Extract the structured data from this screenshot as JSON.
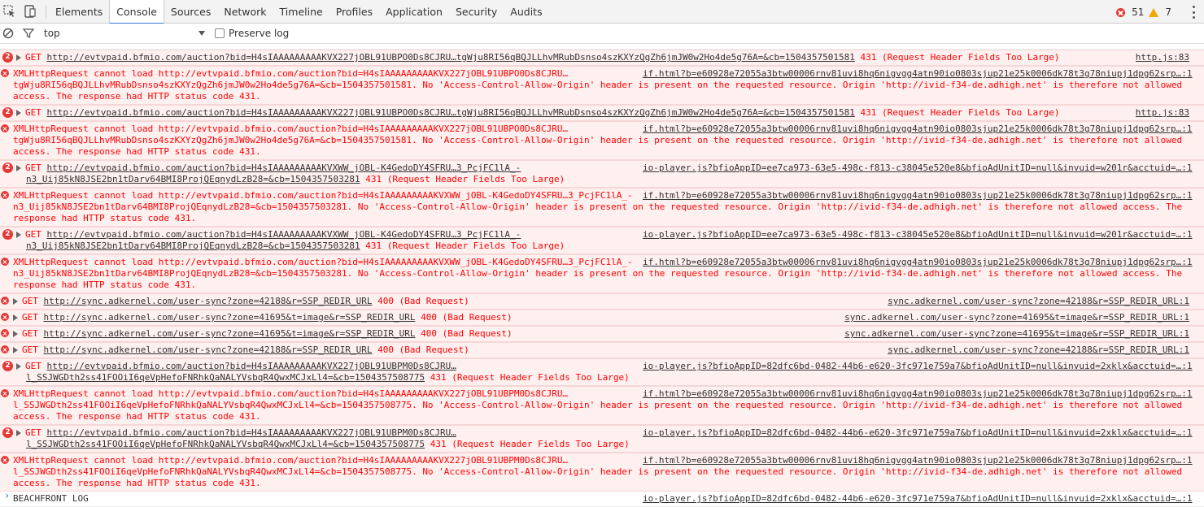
{
  "tabs": [
    "Elements",
    "Console",
    "Sources",
    "Network",
    "Timeline",
    "Profiles",
    "Application",
    "Security",
    "Audits"
  ],
  "active_tab": "Console",
  "counts": {
    "errors": "51",
    "warnings": "7"
  },
  "filter": {
    "context": "top",
    "preserve_log": "Preserve log"
  },
  "colors": {
    "error_bg": "#fff0f0",
    "error_text": "#ff0000",
    "badge": "#e53935",
    "accent": "#3879d9"
  },
  "rows": [
    {
      "type": "get",
      "count": "2",
      "url": "http://evtvpaid.bfmio.com/auction?bid=H4sIAAAAAAAAAKVX227jOBL91UBPO0Ds8CJRU…tgWju8RI56qBQJLLhvMRubDsnso4szKXYzQgZh6jmJW0w2Ho4de5g76A=&cb=1504357501581",
      "status": "431 (Request Header Fields Too Large)",
      "src": "http.js:83"
    },
    {
      "type": "xhr",
      "l1": "XMLHttpRequest cannot load http://evtvpaid.bfmio.com/auction?bid=H4sIAAAAAAAAAKVX227jOBL91UBPO0Ds8CJRU…",
      "l2": "tgWju8RI56qBQJLLhvMRubDsnso4szKXYzQgZh6jmJW0w2Ho4de5g76A=&cb=1504357501581. No 'Access-Control-Allow-Origin' header is present on the requested resource. Origin 'http://ivid-f34-de.adhigh.net' is therefore not allowed",
      "l3": "access. The response had HTTP status code 431.",
      "src": "if.html?b=e60928e72055a3btw00006rnv81uvi8hq6nigvgg4atn90io0803sjup21e25k0006dk78t3g78niupj1dpg62srp…:1"
    },
    {
      "type": "get",
      "count": "2",
      "url": "http://evtvpaid.bfmio.com/auction?bid=H4sIAAAAAAAAAKVX227jOBL91UBPO0Ds8CJRU…tgWju8RI56qBQJLLhvMRubDsnso4szKXYzQgZh6jmJW0w2Ho4de5g76A=&cb=1504357501581",
      "status": "431 (Request Header Fields Too Large)",
      "src": "http.js:83"
    },
    {
      "type": "xhr",
      "l1": "XMLHttpRequest cannot load http://evtvpaid.bfmio.com/auction?bid=H4sIAAAAAAAAAKVX227jOBL91UBPO0Ds8CJRU…",
      "l2": "tgWju8RI56qBQJLLhvMRubDsnso4szKXYzQgZh6jmJW0w2Ho4de5g76A=&cb=1504357501581. No 'Access-Control-Allow-Origin' header is present on the requested resource. Origin 'http://ivid-f34-de.adhigh.net' is therefore not allowed",
      "l3": "access. The response had HTTP status code 431.",
      "src": "if.html?b=e60928e72055a3btw00006rnv81uvi8hq6nigvgg4atn90io0803sjup21e25k0006dk78t3g78niupj1dpg62srp…:1"
    },
    {
      "type": "get2",
      "count": "2",
      "url": "http://evtvpaid.bfmio.com/auction?bid=H4sIAAAAAAAAAKVXWW_jOBL-K4GedoDY4SFRU…3_PcjFC1lA_-",
      "url2": "n3_Uij85kN8JSE2bn1tDarv64BMI8ProjQEqnydLzB28=&cb=1504357503281",
      "status": "431 (Request Header Fields Too Large)",
      "src": "io-player.js?bfioAppID=ee7ca973-63e5-498c-f813-c38045e520e8&bfioAdUnitID=null&invuid=w201r&acctuid=…:1"
    },
    {
      "type": "xhr",
      "l1": "XMLHttpRequest cannot load http://evtvpaid.bfmio.com/auction?bid=H4sIAAAAAAAAAKVXWW_jOBL-K4GedoDY4SFRU…3_PcjFC1lA_-",
      "l2": "n3_Uij85kN8JSE2bn1tDarv64BMI8ProjQEqnydLzB28=&cb=1504357503281. No 'Access-Control-Allow-Origin' header is present on the requested resource. Origin 'http://ivid-f34-de.adhigh.net' is therefore not allowed access. The",
      "l3": "response had HTTP status code 431.",
      "src": "if.html?b=e60928e72055a3btw00006rnv81uvi8hq6nigvgg4atn90io0803sjup21e25k0006dk78t3g78niupj1dpg62srp…:1"
    },
    {
      "type": "get2",
      "count": "2",
      "url": "http://evtvpaid.bfmio.com/auction?bid=H4sIAAAAAAAAAKVXWW_jOBL-K4GedoDY4SFRU…3_PcjFC1lA_-",
      "url2": "n3_Uij85kN8JSE2bn1tDarv64BMI8ProjQEqnydLzB28=&cb=1504357503281",
      "status": "431 (Request Header Fields Too Large)",
      "src": "io-player.js?bfioAppID=ee7ca973-63e5-498c-f813-c38045e520e8&bfioAdUnitID=null&invuid=w201r&acctuid=…:1"
    },
    {
      "type": "xhr",
      "l1": "XMLHttpRequest cannot load http://evtvpaid.bfmio.com/auction?bid=H4sIAAAAAAAAAKVXWW_jOBL-K4GedoDY4SFRU…3_PcjFC1lA_-",
      "l2": "n3_Uij85kN8JSE2bn1tDarv64BMI8ProjQEqnydLzB28=&cb=1504357503281. No 'Access-Control-Allow-Origin' header is present on the requested resource. Origin 'http://ivid-f34-de.adhigh.net' is therefore not allowed access. The",
      "l3": "response had HTTP status code 431.",
      "src": "if.html?b=e60928e72055a3btw00006rnv81uvi8hq6nigvgg4atn90io0803sjup21e25k0006dk78t3g78niupj1dpg62srp…:1"
    },
    {
      "type": "sync",
      "url": "http://sync.adkernel.com/user-sync?zone=42188&r=SSP_REDIR_URL",
      "status": "400 (Bad Request)",
      "src": "sync.adkernel.com/user-sync?zone=42188&r=SSP_REDIR_URL:1"
    },
    {
      "type": "sync",
      "url": "http://sync.adkernel.com/user-sync?zone=41695&t=image&r=SSP_REDIR_URL",
      "status": "400 (Bad Request)",
      "src": "sync.adkernel.com/user-sync?zone=41695&t=image&r=SSP_REDIR_URL:1"
    },
    {
      "type": "sync",
      "url": "http://sync.adkernel.com/user-sync?zone=41695&t=image&r=SSP_REDIR_URL",
      "status": "400 (Bad Request)",
      "src": "sync.adkernel.com/user-sync?zone=41695&t=image&r=SSP_REDIR_URL:1"
    },
    {
      "type": "sync",
      "url": "http://sync.adkernel.com/user-sync?zone=42188&r=SSP_REDIR_URL",
      "status": "400 (Bad Request)",
      "src": "sync.adkernel.com/user-sync?zone=42188&r=SSP_REDIR_URL:1"
    },
    {
      "type": "get2",
      "count": "2",
      "url": "http://evtvpaid.bfmio.com/auction?bid=H4sIAAAAAAAAAKVX227jOBL91UBPM0Ds8CJRU…",
      "url2": "l_SSJWGDth2ss41FOOiI6qeVpHefoFNRhkQaNALYVsbqR4QwxMCJxLl4=&cb=1504357508775",
      "status": "431 (Request Header Fields Too Large)",
      "src": "io-player.js?bfioAppID=82dfc6bd-0482-44b6-e620-3fc971e759a7&bfioAdUnitID=null&invuid=2xklx&acctuid=…:1"
    },
    {
      "type": "xhr",
      "l1": "XMLHttpRequest cannot load http://evtvpaid.bfmio.com/auction?bid=H4sIAAAAAAAAAKVX227jOBL91UBPM0Ds8CJRU…",
      "l2": "l_SSJWGDth2ss41FOOiI6qeVpHefoFNRhkQaNALYVsbqR4QwxMCJxLl4=&cb=1504357508775. No 'Access-Control-Allow-Origin' header is present on the requested resource. Origin 'http://ivid-f34-de.adhigh.net' is therefore not allowed",
      "l3": "access. The response had HTTP status code 431.",
      "src": "if.html?b=e60928e72055a3btw00006rnv81uvi8hq6nigvgg4atn90io0803sjup21e25k0006dk78t3g78niupj1dpg62srp…:1"
    },
    {
      "type": "get2",
      "count": "2",
      "url": "http://evtvpaid.bfmio.com/auction?bid=H4sIAAAAAAAAAKVX227jOBL91UBPM0Ds8CJRU…",
      "url2": "l_SSJWGDth2ss41FOOiI6qeVpHefoFNRhkQaNALYVsbqR4QwxMCJxLl4=&cb=1504357508775",
      "status": "431 (Request Header Fields Too Large)",
      "src": "io-player.js?bfioAppID=82dfc6bd-0482-44b6-e620-3fc971e759a7&bfioAdUnitID=null&invuid=2xklx&acctuid=…:1"
    },
    {
      "type": "xhr",
      "l1": "XMLHttpRequest cannot load http://evtvpaid.bfmio.com/auction?bid=H4sIAAAAAAAAAKVX227jOBL91UBPM0Ds8CJRU…",
      "l2": "l_SSJWGDth2ss41FOOiI6qeVpHefoFNRhkQaNALYVsbqR4QwxMCJxLl4=&cb=1504357508775. No 'Access-Control-Allow-Origin' header is present on the requested resource. Origin 'http://ivid-f34-de.adhigh.net' is therefore not allowed",
      "l3": "access. The response had HTTP status code 431.",
      "src": "if.html?b=e60928e72055a3btw00006rnv81uvi8hq6nigvgg4atn90io0803sjup21e25k0006dk78t3g78niupj1dpg62srp…:1"
    },
    {
      "type": "log",
      "text": "BEACHFRONT LOG",
      "src": "io-player.js?bfioAppID=82dfc6bd-0482-44b6-e620-3fc971e759a7&bfioAdUnitID=null&invuid=2xklx&acctuid=…:1"
    }
  ]
}
